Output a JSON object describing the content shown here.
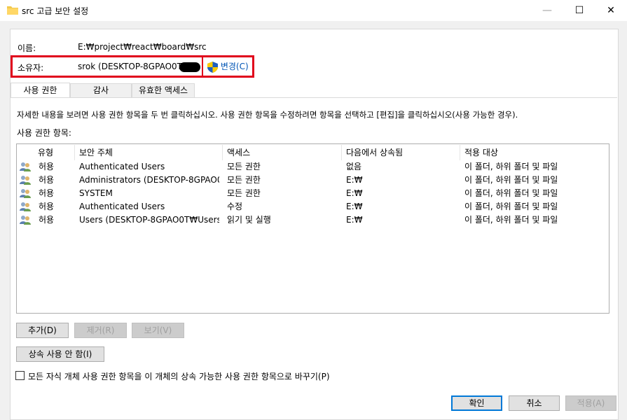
{
  "window": {
    "title": "src 고급 보안 설정",
    "minimize": "—",
    "maximize": "☐",
    "close": "✕"
  },
  "info": {
    "name_label": "이름:",
    "name_value": "E:₩project₩react₩board₩src",
    "owner_label": "소유자:",
    "owner_value": "srok (DESKTOP-8GPAO0T₩",
    "change_link": "변경(C)",
    "highlight_color": "#e0001b"
  },
  "tabs": [
    "사용 권한",
    "감사",
    "유효한 액세스"
  ],
  "instructions": "자세한 내용을 보려면 사용 권한 항목을 두 번 클릭하십시오. 사용 권한 항목을 수정하려면 항목을 선택하고 [편집]을 클릭하십시오(사용 가능한 경우).",
  "entries_label": "사용 권한 항목:",
  "table": {
    "columns": [
      "유형",
      "보안 주체",
      "액세스",
      "다음에서 상속됨",
      "적용 대상"
    ],
    "rows": [
      {
        "type": "허용",
        "principal": "Authenticated Users",
        "access": "모든 권한",
        "inherited": "없음",
        "applies": "이 폴더, 하위 폴더 및 파일"
      },
      {
        "type": "허용",
        "principal": "Administrators (DESKTOP-8GPAO0...",
        "access": "모든 권한",
        "inherited": "E:₩",
        "applies": "이 폴더, 하위 폴더 및 파일"
      },
      {
        "type": "허용",
        "principal": "SYSTEM",
        "access": "모든 권한",
        "inherited": "E:₩",
        "applies": "이 폴더, 하위 폴더 및 파일"
      },
      {
        "type": "허용",
        "principal": "Authenticated Users",
        "access": "수정",
        "inherited": "E:₩",
        "applies": "이 폴더, 하위 폴더 및 파일"
      },
      {
        "type": "허용",
        "principal": "Users (DESKTOP-8GPAO0T₩Users)",
        "access": "읽기 및 실행",
        "inherited": "E:₩",
        "applies": "이 폴더, 하위 폴더 및 파일"
      }
    ]
  },
  "buttons": {
    "add": "추가(D)",
    "remove": "제거(R)",
    "view": "보기(V)",
    "disable_inheritance": "상속 사용 안 함(I)",
    "replace_label": "모든 자식 개체 사용 권한 항목을 이 개체의 상속 가능한 사용 권한 항목으로 바꾸기(P)",
    "ok": "확인",
    "cancel": "취소",
    "apply": "적용(A)"
  }
}
